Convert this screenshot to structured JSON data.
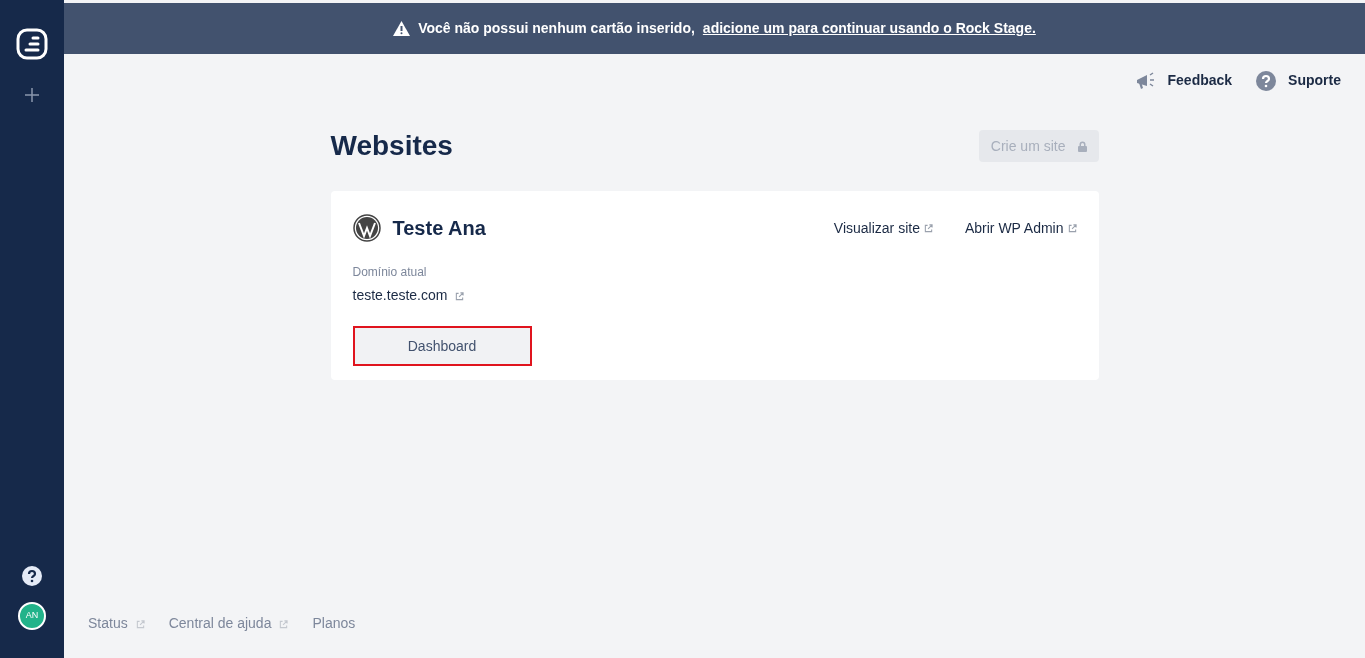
{
  "sidebar": {
    "avatar": "AN"
  },
  "banner": {
    "text": "Você não possui nenhum cartão inserido,",
    "link": "adicione um para continuar usando o Rock Stage."
  },
  "top_links": [
    {
      "kind": "feedback",
      "label": "Feedback"
    },
    {
      "kind": "support",
      "label": "Suporte"
    }
  ],
  "page": {
    "title": "Websites",
    "create_button": {
      "label": "Crie um site",
      "disabled": true
    }
  },
  "site": {
    "name": "Teste Ana",
    "links": [
      {
        "label": "Visualizar site"
      },
      {
        "label": "Abrir WP Admin"
      }
    ],
    "domain_label": "Domínio atual",
    "domain": "teste.teste.com",
    "button": {
      "label": "Dashboard",
      "highlighted": true
    }
  },
  "footer": [
    {
      "label": "Status",
      "external": true
    },
    {
      "label": "Central de ajuda",
      "external": true
    },
    {
      "label": "Planos",
      "external": false
    }
  ]
}
